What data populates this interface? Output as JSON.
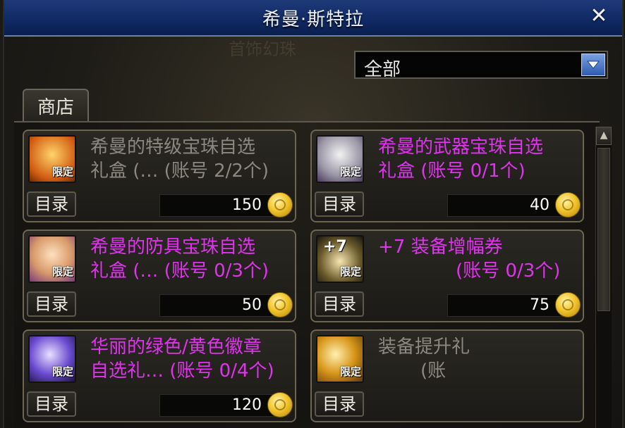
{
  "window": {
    "title": "希曼·斯特拉",
    "close_glyph": "✕"
  },
  "background_text": "首饰幻珠",
  "filter": {
    "selected": "全部"
  },
  "tabs": [
    {
      "label": "商店"
    }
  ],
  "colors": {
    "accent_title": "#0b2a6a",
    "item_name_purple": "#e033ee",
    "item_name_grey": "#8a887f"
  },
  "items": [
    {
      "name_line1": "希曼的特级宝珠自选",
      "name_line2": "礼盒 (… (账号 2/2个)",
      "badge": "限定",
      "catalog": "目录",
      "price": "150",
      "available": false,
      "icon": "orange-giftbox-icon"
    },
    {
      "name_line1": "希曼的武器宝珠自选",
      "name_line2": "礼盒  (账号 0/1个)",
      "badge": "限定",
      "catalog": "目录",
      "price": "40",
      "available": true,
      "icon": "white-giftbox-icon"
    },
    {
      "name_line1": "希曼的防具宝珠自选",
      "name_line2": "礼盒 (… (账号 0/3个)",
      "badge": "限定",
      "catalog": "目录",
      "price": "50",
      "available": true,
      "icon": "character-giftbox-icon"
    },
    {
      "name_line1": "+7 装备增幅券",
      "name_line2": "(账号 0/3个)",
      "badge": "限定",
      "plus_label": "+7",
      "catalog": "目录",
      "price": "75",
      "available": true,
      "icon": "amplify-ticket-icon"
    },
    {
      "name_line1": "华丽的绿色/黄色徽章",
      "name_line2": "自选礼… (账号 0/4个)",
      "badge": "限定",
      "catalog": "目录",
      "price": "120",
      "available": true,
      "icon": "purple-emblem-box-icon"
    },
    {
      "name_line1": "装备提升礼",
      "name_line2": "(账",
      "badge": "限定",
      "catalog": "目录",
      "price": "",
      "available": false,
      "icon": "gold-orb-icon"
    }
  ]
}
